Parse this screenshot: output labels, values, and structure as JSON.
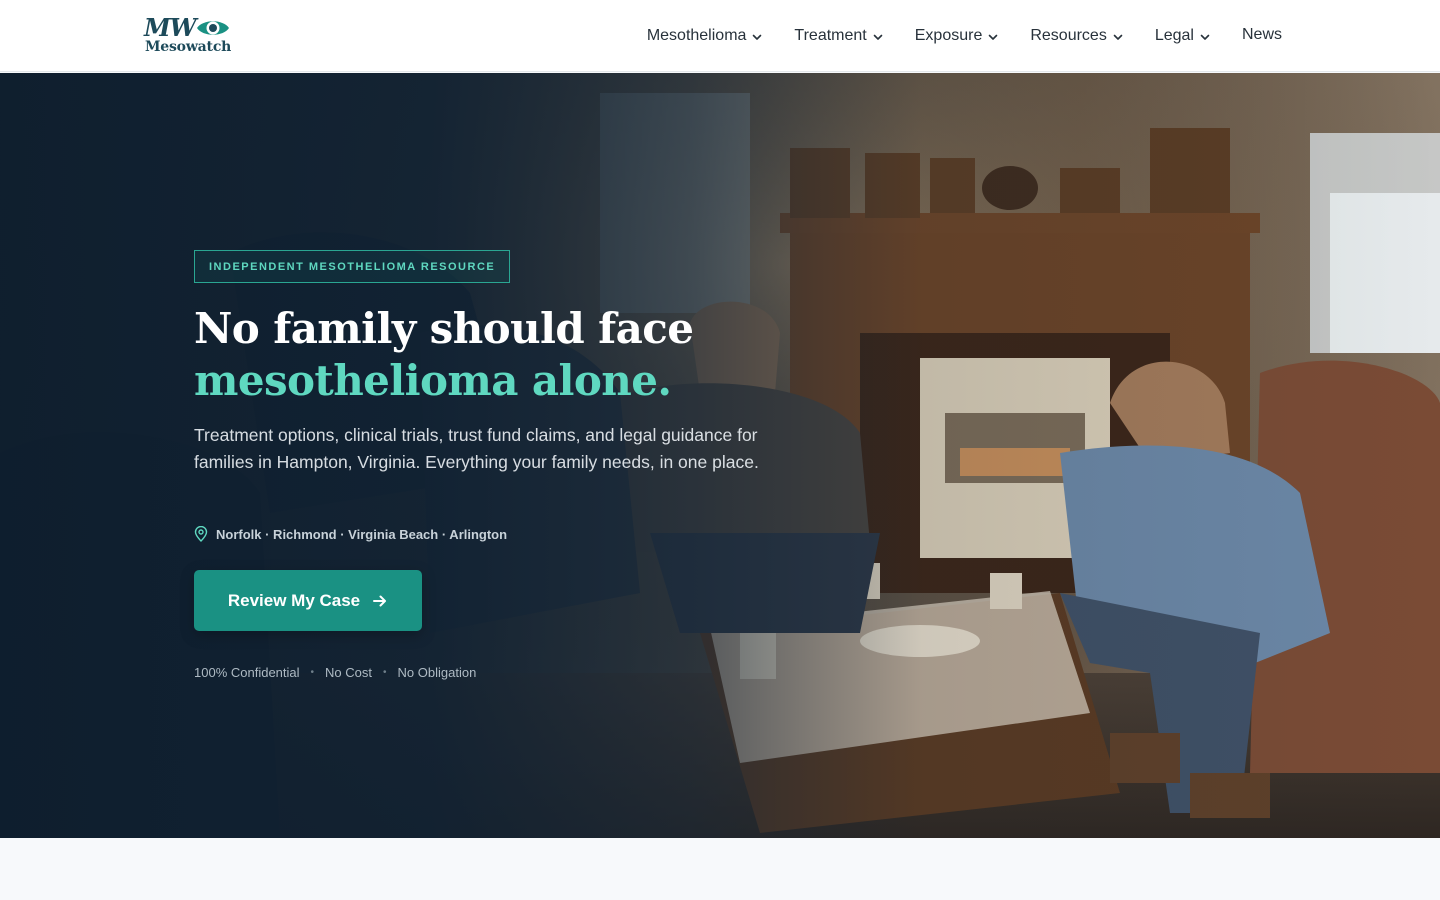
{
  "brand": {
    "logo_initials": "MW",
    "logo_word": "Mesowatch",
    "colors": {
      "primary_dark": "#1d4a5a",
      "teal": "#1a9183",
      "teal_light": "#5fd8c0"
    }
  },
  "nav": {
    "items": [
      {
        "label": "Mesothelioma",
        "has_dropdown": true,
        "icon": "chevron-down-icon"
      },
      {
        "label": "Treatment",
        "has_dropdown": true,
        "icon": "chevron-down-icon"
      },
      {
        "label": "Exposure",
        "has_dropdown": true,
        "icon": "chevron-down-icon"
      },
      {
        "label": "Resources",
        "has_dropdown": true,
        "icon": "chevron-down-icon"
      },
      {
        "label": "Legal",
        "has_dropdown": true,
        "icon": "chevron-down-icon"
      },
      {
        "label": "News",
        "has_dropdown": false
      }
    ]
  },
  "hero": {
    "tag": "INDEPENDENT MESOTHELIOMA RESOURCE",
    "headline_line1": "No family should face",
    "headline_line2": "mesothelioma alone.",
    "lead": "Treatment options, clinical trials, trust fund claims, and legal guidance for families in Hampton, Virginia. Everything your family needs, in one place.",
    "location_icon": "map-pin-icon",
    "cities": "Norfolk · Richmond · Virginia Beach · Arlington",
    "cta_label": "Review My Case",
    "cta_icon": "arrow-right-icon",
    "assurances": [
      "100% Confidential",
      "No Cost",
      "No Obligation"
    ],
    "assurance_separator": "•"
  }
}
